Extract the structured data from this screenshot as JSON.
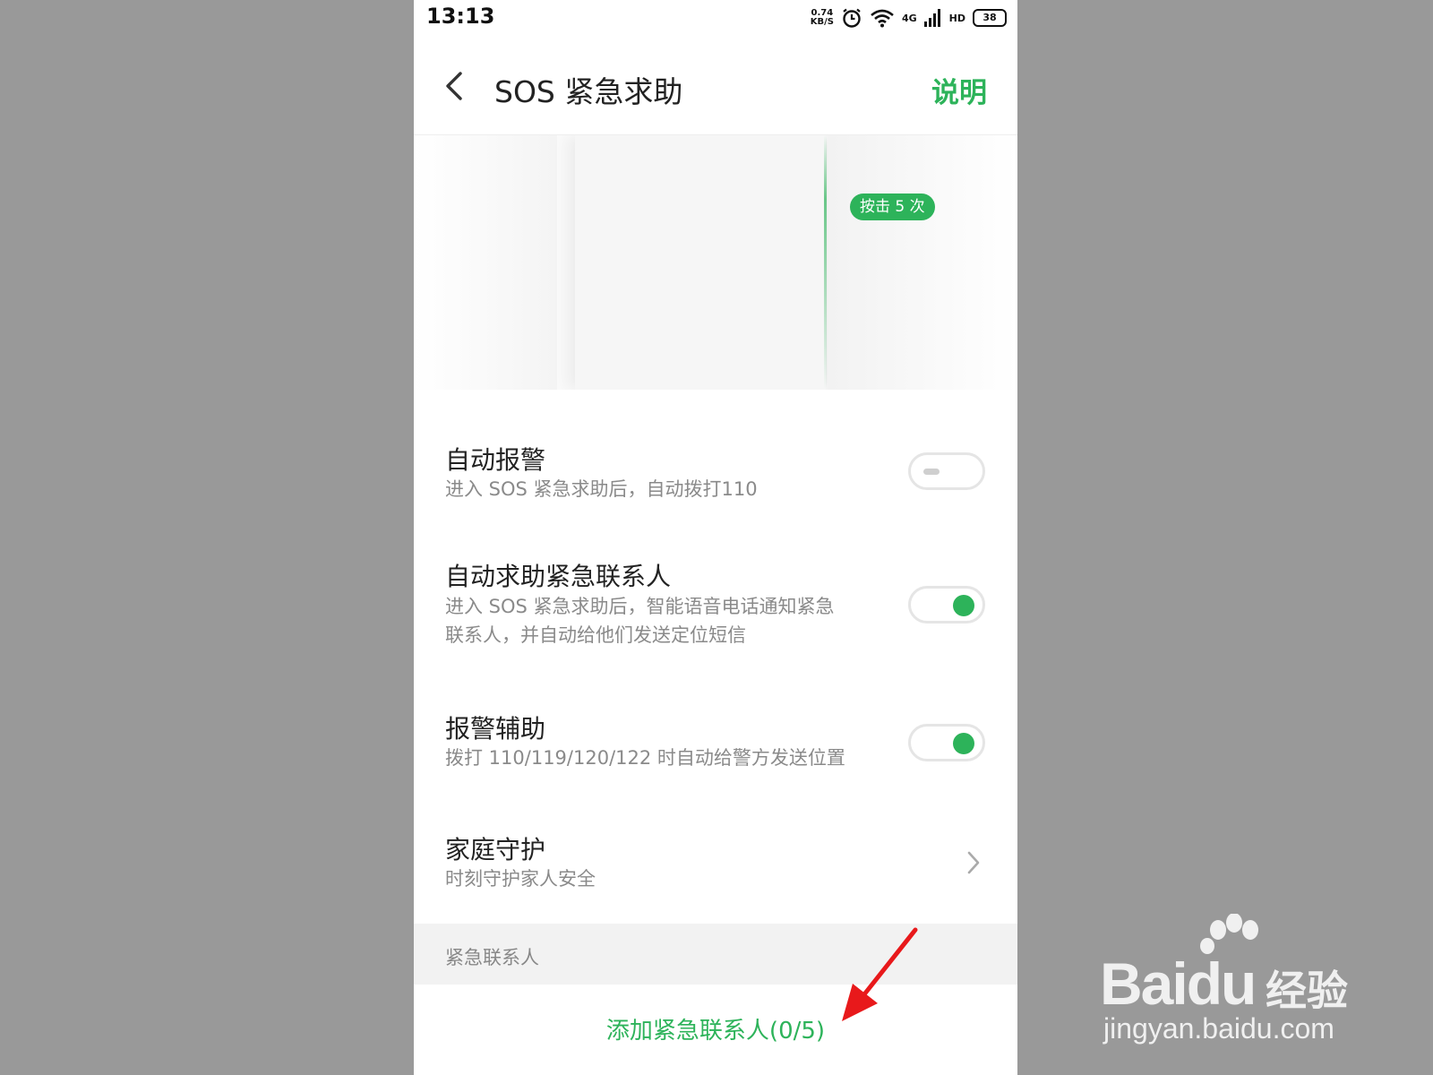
{
  "status_bar": {
    "time": "13:13",
    "net_speed_value": "0.74",
    "net_speed_unit": "KB/S",
    "network_type": "4G",
    "hd_label": "HD",
    "battery": "38"
  },
  "header": {
    "title": "SOS 紧急求助",
    "help_label": "说明"
  },
  "illustration": {
    "press_badge": "按击 5 次"
  },
  "settings": [
    {
      "title": "自动报警",
      "description": "进入 SOS 紧急求助后，自动拨打110",
      "enabled": false
    },
    {
      "title": "自动求助紧急联系人",
      "description_line1": "进入 SOS 紧急求助后，智能语音电话通知紧急",
      "description_line2": "联系人，并自动给他们发送定位短信",
      "enabled": true
    },
    {
      "title": "报警辅助",
      "description": "拨打 110/119/120/122 时自动给警方发送位置",
      "enabled": true
    },
    {
      "title": "家庭守护",
      "description": "时刻守护家人安全"
    }
  ],
  "contacts_section": {
    "header": "紧急联系人",
    "add_label": "添加紧急联系人(0/5)"
  },
  "watermark": {
    "brand": "Baidu",
    "brand_cn": "经验",
    "url": "jingyan.baidu.com"
  },
  "colors": {
    "accent": "#2db35a",
    "background": "#999999",
    "annotation_arrow": "#e8191b"
  }
}
